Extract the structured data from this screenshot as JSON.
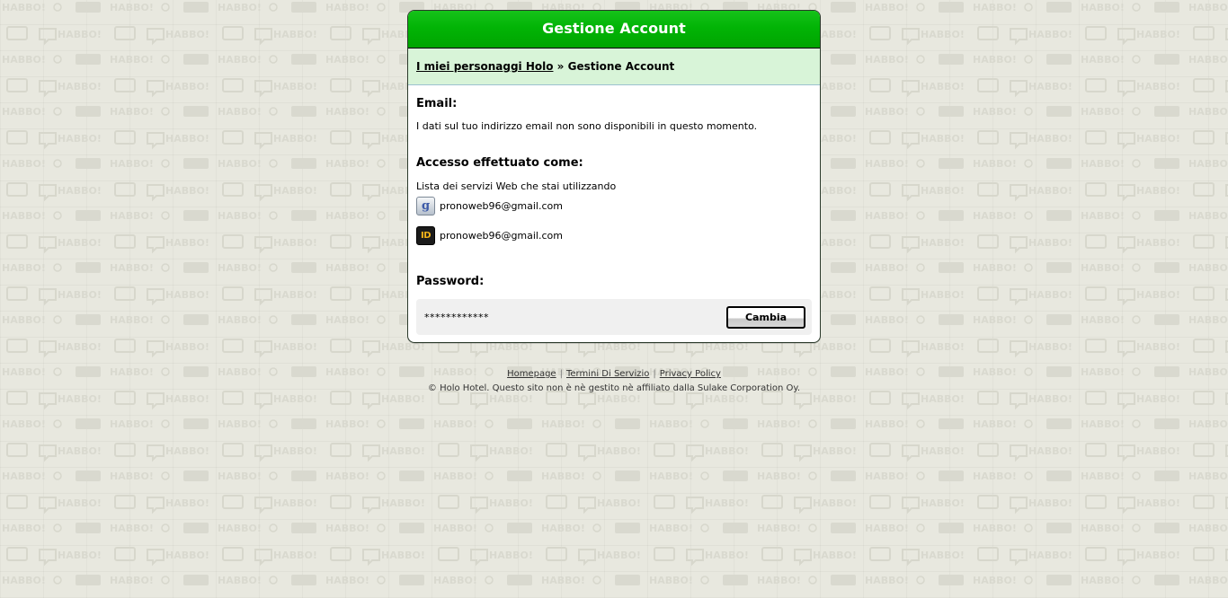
{
  "header": {
    "title": "Gestione Account"
  },
  "breadcrumb": {
    "link_label": "I miei personaggi Holo",
    "separator": "»",
    "current": "Gestione Account"
  },
  "email": {
    "title": "Email:",
    "text": "I dati sul tuo indirizzo email non sono disponibili in questo momento."
  },
  "access": {
    "title": "Accesso effettuato come:",
    "subtitle": "Lista dei servizi Web che stai utilizzando",
    "services": [
      {
        "icon": "google-icon",
        "icon_glyph": "g",
        "email": "pronoweb96@gmail.com"
      },
      {
        "icon": "id-icon",
        "icon_glyph": "ID",
        "email": "pronoweb96@gmail.com"
      }
    ]
  },
  "password": {
    "title": "Password:",
    "masked_value": "************",
    "change_label": "Cambia"
  },
  "footer": {
    "links": [
      "Homepage",
      "Termini Di Servizio",
      "Privacy Policy"
    ],
    "link_separator": "|",
    "copyright": "© Holo Hotel. Questo sito non è nè gestito nè affiliato dalla Sulake Corporation Oy."
  },
  "colors": {
    "header_green": "#00b300",
    "breadcrumb_bg": "#d8f4d8",
    "page_bg": "#e8e8df"
  },
  "background_pattern_text": "HABBO!"
}
